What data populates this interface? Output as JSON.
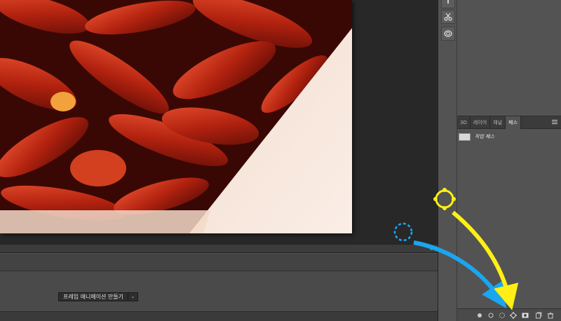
{
  "timeline": {
    "create_animation_label": "프레임 애니메이션 만들기",
    "panel_menu": "≡"
  },
  "panel_tabs": [
    {
      "label": "3D"
    },
    {
      "label": "레이어"
    },
    {
      "label": "채널"
    },
    {
      "label": "패스"
    }
  ],
  "paths": {
    "items": [
      {
        "label": "작업 패스"
      }
    ]
  },
  "tools": [
    {
      "icon": "menu-grip-icon"
    },
    {
      "icon": "scissors-icon"
    },
    {
      "icon": "swirl-icon"
    }
  ],
  "paths_footer_icons": [
    "fill-path-icon",
    "stroke-path-icon",
    "load-as-selection-icon",
    "make-work-path-icon",
    "add-mask-icon",
    "new-path-icon",
    "delete-path-icon"
  ],
  "colors": {
    "highlight_blue": "#1aa6f0",
    "highlight_yellow": "#ffef14",
    "active_tab": "#535353"
  }
}
